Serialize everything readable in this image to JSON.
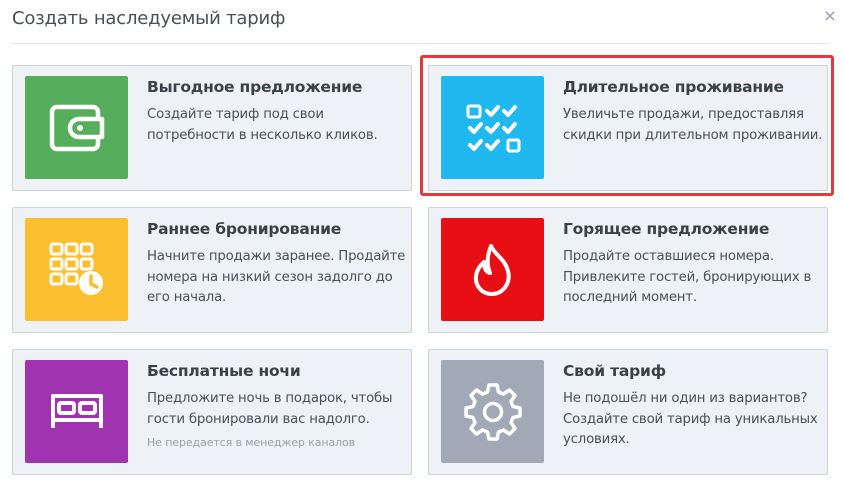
{
  "modal": {
    "title": "Создать наследуемый тариф",
    "close_glyph": "×"
  },
  "colors": {
    "green": "#56ad5c",
    "blue": "#1fb9f0",
    "yellow": "#fbbf2f",
    "red": "#e80f14",
    "purple": "#a033b0",
    "gray": "#a0a9b5",
    "highlight": "#e0393e"
  },
  "cards": [
    {
      "title": "Выгодное предложение",
      "desc": "Создайте тариф под свои потребности в несколько кликов.",
      "icon": "wallet-icon"
    },
    {
      "title": "Длительное проживание",
      "desc": "Увеличьте продажи, предоставляя скидки при длительном проживании.",
      "icon": "checklist-icon"
    },
    {
      "title": "Раннее бронирование",
      "desc": "Начните продажи заранее. Продайте номера на низкий сезон задолго до его начала.",
      "icon": "calendar-clock-icon"
    },
    {
      "title": "Горящее предложение",
      "desc": "Продайте оставшиеся номера. Привлеките гостей, бронирующих в последний момент.",
      "icon": "flame-icon"
    },
    {
      "title": "Бесплатные ночи",
      "desc": "Предложите ночь в подарок, чтобы гости бронировали вас надолго.",
      "note": "Не передается в менеджер каналов",
      "icon": "bed-icon"
    },
    {
      "title": "Свой тариф",
      "desc": "Не подошёл ни один из вариантов? Создайте свой тариф на уникальных условиях.",
      "icon": "gear-icon"
    }
  ]
}
